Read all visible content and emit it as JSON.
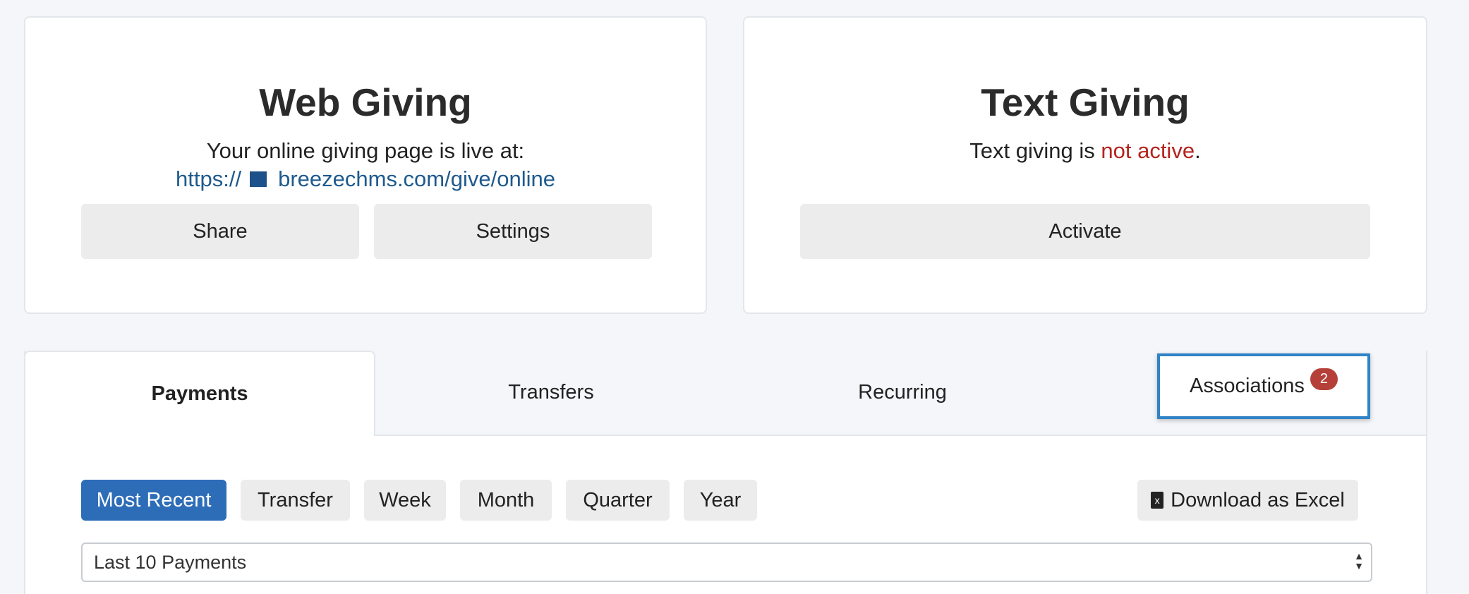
{
  "web_giving": {
    "title": "Web Giving",
    "live_text": "Your online giving page is live at:",
    "url_prefix": "https://",
    "url_suffix": "breezechms.com/give/online",
    "share_label": "Share",
    "settings_label": "Settings"
  },
  "text_giving": {
    "title": "Text Giving",
    "status_prefix": "Text giving is ",
    "status_value": "not active",
    "status_suffix": ".",
    "activate_label": "Activate"
  },
  "tabs": [
    {
      "label": "Payments"
    },
    {
      "label": "Transfers"
    },
    {
      "label": "Recurring"
    },
    {
      "label": "Associations",
      "badge": "2"
    }
  ],
  "filters": {
    "options": [
      "Most Recent",
      "Transfer",
      "Week",
      "Month",
      "Quarter",
      "Year"
    ],
    "download_label": "Download as Excel"
  },
  "select": {
    "value": "Last 10 Payments"
  },
  "colors": {
    "accent": "#2d6db8",
    "highlight": "#2f83c6",
    "inactive": "#b5231e",
    "badge": "#b5403a"
  }
}
